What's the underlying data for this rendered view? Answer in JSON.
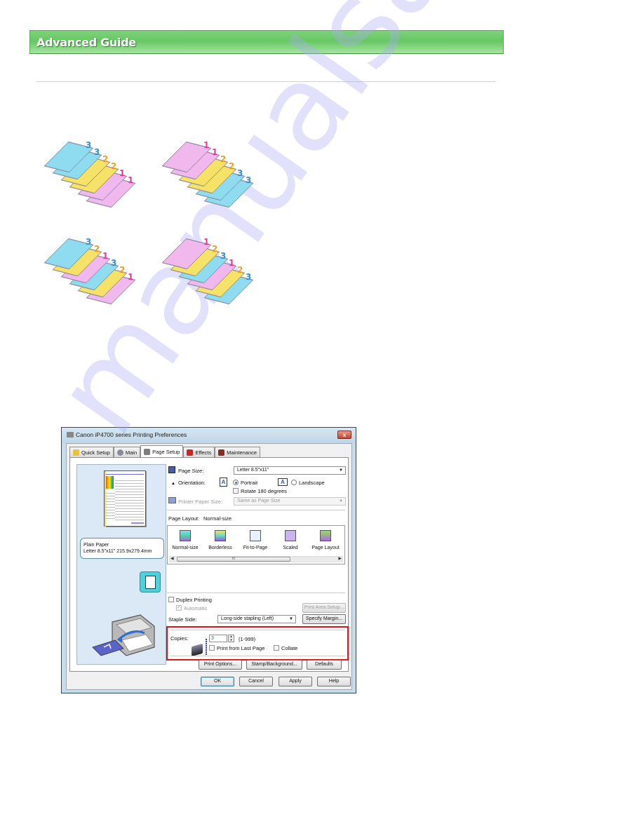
{
  "header": {
    "title": "Advanced Guide",
    "bar_color": "#66c763"
  },
  "illustrations": [
    {
      "name": "reverse-order-collated-off",
      "numbers": [
        "3",
        "3",
        "2",
        "2",
        "1",
        "1"
      ]
    },
    {
      "name": "normal-order-collated-off",
      "numbers": [
        "1",
        "1",
        "2",
        "2",
        "3",
        "3"
      ]
    },
    {
      "name": "reverse-order-collated-on",
      "numbers": [
        "3",
        "2",
        "1",
        "3",
        "2",
        "1"
      ]
    },
    {
      "name": "normal-order-collated-on",
      "numbers": [
        "1",
        "2",
        "3",
        "1",
        "2",
        "3"
      ]
    }
  ],
  "number_colors": {
    "1": "#e8359f",
    "2": "#f39a22",
    "3": "#2f8fd8"
  },
  "dialog": {
    "title": "Canon iP4700 series Printing Preferences",
    "close_label": "x",
    "tabs": [
      {
        "label": "Quick Setup",
        "active": false
      },
      {
        "label": "Main",
        "active": false
      },
      {
        "label": "Page Setup",
        "active": true
      },
      {
        "label": "Effects",
        "active": false
      },
      {
        "label": "Maintenance",
        "active": false
      }
    ],
    "preview": {
      "paper_type": "Plain Paper",
      "paper_size": "Letter 8.5\"x11\" 215.9x279.4mm"
    },
    "page_size": {
      "label": "Page Size:",
      "value": "Letter 8.5\"x11\""
    },
    "orientation": {
      "label": "Orientation:",
      "portrait": "Portrait",
      "landscape": "Landscape",
      "selected": "Portrait",
      "rotate_label": "Rotate 180 degrees",
      "rotate_checked": false
    },
    "printer_paper_size": {
      "label": "Printer Paper Size:",
      "value": "Same as Page Size",
      "disabled": true
    },
    "page_layout": {
      "label": "Page Layout:",
      "value": "Normal-size",
      "items": [
        "Normal-size",
        "Borderless",
        "Fit-to-Page",
        "Scaled",
        "Page Layout"
      ],
      "scroll_thumb": "III"
    },
    "duplex": {
      "label": "Duplex Printing",
      "checked": false,
      "automatic_label": "Automatic",
      "automatic_checked": true
    },
    "print_area_setup": "Print Area Setup...",
    "staple_side": {
      "label": "Staple Side:",
      "value": "Long-side stapling (Left)"
    },
    "specify_margin": "Specify Margin...",
    "copies": {
      "label": "Copies:",
      "value": "3",
      "range": "(1-999)",
      "print_from_last_label": "Print from Last Page",
      "print_from_last_checked": false,
      "collate_label": "Collate",
      "collate_checked": false
    },
    "buttons": {
      "print_options": "Print Options...",
      "stamp_background": "Stamp/Background...",
      "defaults": "Defaults",
      "ok": "OK",
      "cancel": "Cancel",
      "apply": "Apply",
      "help": "Help"
    },
    "highlight_color": "#e0121a"
  },
  "watermark": "manualsarchive.com"
}
